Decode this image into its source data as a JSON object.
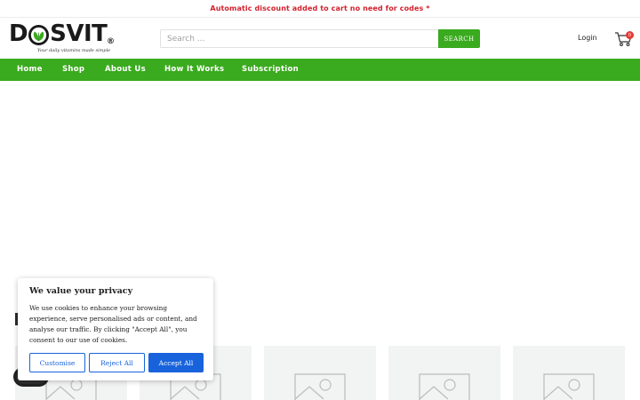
{
  "announcement": {
    "text": "Automatic discount added to cart no need for codes *"
  },
  "brand": {
    "name_left": "D",
    "name_right": "SVIT",
    "registered": "®",
    "tagline": "Your daily vitamins made simple"
  },
  "search": {
    "placeholder": "Search ...",
    "button_label": "SEARCH"
  },
  "header": {
    "login_label": "Login",
    "cart_count": "0"
  },
  "nav": {
    "items": [
      {
        "label": "Home"
      },
      {
        "label": "Shop"
      },
      {
        "label": "About Us"
      },
      {
        "label": "How It Works"
      },
      {
        "label": "Subscription"
      }
    ]
  },
  "cookie": {
    "title": "We value your privacy",
    "text": "We use cookies to enhance your browsing experience, serve personalised ads or content, and analyse our traffic. By clicking \"Accept All\", you consent to our use of cookies.",
    "customise_label": "Customise",
    "reject_label": "Reject All",
    "accept_label": "Accept All"
  },
  "colors": {
    "brand_green": "#3aaa1e",
    "announcement_red": "#d0202c",
    "cookie_blue": "#1863dc",
    "cart_badge": "#e53935"
  },
  "icons": {
    "cart": "shopping-cart-icon",
    "product_placeholder": "image-placeholder-icon",
    "chat": "chat-bubble-icon"
  }
}
